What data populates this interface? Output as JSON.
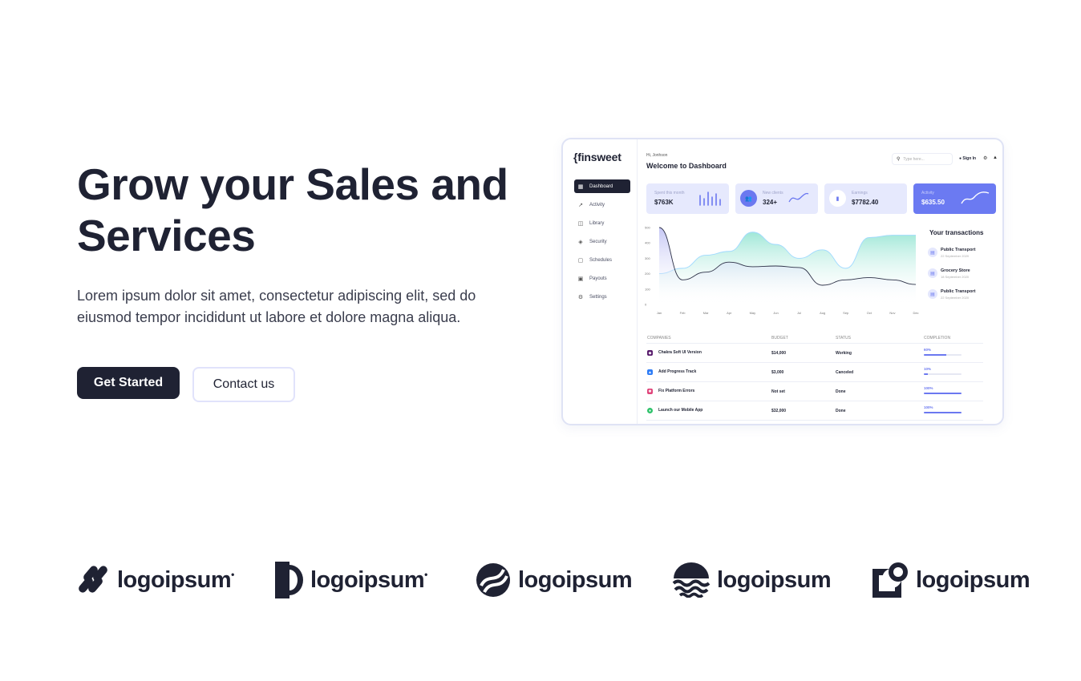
{
  "hero": {
    "title": "Grow your Sales and Services",
    "description": "Lorem ipsum dolor sit amet, consectetur adipiscing elit, sed do eiusmod tempor incididunt ut labore et dolore magna aliqua.",
    "primary_cta": "Get Started",
    "secondary_cta": "Contact us"
  },
  "dashboard": {
    "brand": "{finsweet",
    "greeting": "Hi, Jonhson",
    "welcome": "Welcome to Dashboard",
    "search_placeholder": "Type here...",
    "sign_in": "Sign In",
    "nav": [
      {
        "label": "Dashboard",
        "icon": "grid-icon",
        "active": true
      },
      {
        "label": "Activity",
        "icon": "trend-icon"
      },
      {
        "label": "Library",
        "icon": "bag-icon"
      },
      {
        "label": "Security",
        "icon": "shield-icon"
      },
      {
        "label": "Schedules",
        "icon": "calendar-icon"
      },
      {
        "label": "Payouts",
        "icon": "wallet-icon"
      },
      {
        "label": "Settings",
        "icon": "gear-icon"
      }
    ],
    "cards": [
      {
        "label": "Spent this month",
        "value": "$763K"
      },
      {
        "label": "New clients",
        "value": "324+"
      },
      {
        "label": "Earnings",
        "value": "$7782.40"
      },
      {
        "label": "Activity",
        "value": "$635.50"
      }
    ],
    "transactions_title": "Your transactions",
    "transactions": [
      {
        "name": "Public Transport",
        "date": "22 September 2020"
      },
      {
        "name": "Grocery Store",
        "date": "18 September 2020"
      },
      {
        "name": "Public Transport",
        "date": "22 September 2020"
      }
    ],
    "table": {
      "headers": [
        "COMPANIES",
        "BUDGET",
        "STATUS",
        "COMPLETION"
      ],
      "rows": [
        {
          "company": "Chakra Soft UI Version",
          "budget": "$14,000",
          "status": "Working",
          "completion": "60%",
          "pct": 0.6,
          "color": "#5a1e6e"
        },
        {
          "company": "Add Progress Track",
          "budget": "$3,000",
          "status": "Canceled",
          "completion": "10%",
          "pct": 0.1,
          "color": "#2f7df6"
        },
        {
          "company": "Fix Platform Errors",
          "budget": "Not set",
          "status": "Done",
          "completion": "100%",
          "pct": 1.0,
          "color": "#e0457b"
        },
        {
          "company": "Launch our Mobile App",
          "budget": "$32,000",
          "status": "Done",
          "completion": "100%",
          "pct": 1.0,
          "color": "#2ec26a"
        }
      ]
    }
  },
  "chart_data": {
    "type": "area",
    "categories": [
      "Jan",
      "Feb",
      "Mar",
      "Apr",
      "May",
      "Jun",
      "Jul",
      "Aug",
      "Sep",
      "Oct",
      "Nov",
      "Dec"
    ],
    "yticks": [
      "500",
      "400",
      "300",
      "200",
      "100",
      "0"
    ],
    "ylim": [
      0,
      500
    ],
    "series": [
      {
        "values": [
          200,
          235,
          320,
          345,
          470,
          390,
          300,
          355,
          235,
          435,
          450,
          450
        ],
        "color": "#8fe3d0"
      },
      {
        "values": [
          500,
          160,
          210,
          275,
          245,
          250,
          240,
          125,
          160,
          175,
          160,
          130
        ],
        "color": "#c7c9f4"
      }
    ]
  },
  "logos": [
    {
      "name": "logoipsum",
      "icon": "dots-icon"
    },
    {
      "name": "logoipsum",
      "icon": "half-circle-icon"
    },
    {
      "name": "logoipsum",
      "icon": "striped-circle-icon"
    },
    {
      "name": "logoipsum",
      "icon": "waves-icon"
    },
    {
      "name": "logoipsum",
      "icon": "square-circle-icon"
    }
  ]
}
